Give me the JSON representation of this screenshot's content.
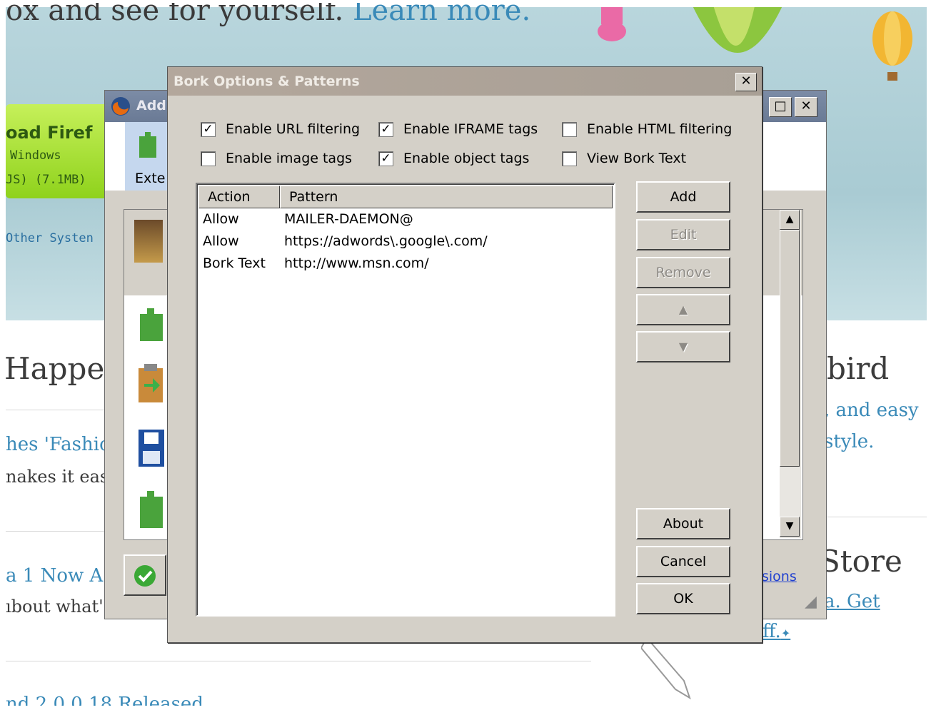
{
  "background_page": {
    "headline": "ox and see for yourself.",
    "headline_link": "Learn more.",
    "download_title": "oad Firef",
    "download_os": "Windows",
    "download_size": "JS) (7.1MB)",
    "other_systems": "Other Systen",
    "happen": "Happer",
    "bird": "bird",
    "and_easy": ", and easy",
    "fashion": "hes 'Fashic",
    "style": "style.",
    "makes_easy": "nakes it eas",
    "store": "Store",
    "beta_now": "a 1 Now A",
    "about_whats": "ıbout what's",
    "get": "a. Get",
    "versions": "sions",
    "ff": "ff.",
    "released": "nd 2.0.0.18 Released"
  },
  "addons_window": {
    "title": "Add",
    "tab_label": "Exte"
  },
  "dialog": {
    "title": "Bork Options & Patterns",
    "close_label": "✕",
    "options": [
      {
        "label": "Enable URL filtering",
        "checked": true
      },
      {
        "label": "Enable IFRAME tags",
        "checked": true
      },
      {
        "label": "Enable HTML filtering",
        "checked": false
      },
      {
        "label": "Enable image tags",
        "checked": false
      },
      {
        "label": "Enable object tags",
        "checked": true
      },
      {
        "label": "View Bork Text",
        "checked": false
      }
    ],
    "columns": {
      "action": "Action",
      "pattern": "Pattern"
    },
    "rows": [
      {
        "action": "Allow",
        "pattern": "MAILER-DAEMON@"
      },
      {
        "action": "Allow",
        "pattern": "https://adwords\\.google\\.com/"
      },
      {
        "action": "Bork Text",
        "pattern": "http://www.msn.com/"
      }
    ],
    "buttons": {
      "add": "Add",
      "edit": "Edit",
      "remove": "Remove",
      "up": "▲",
      "down": "▼",
      "about": "About",
      "cancel": "Cancel",
      "ok": "OK"
    }
  }
}
